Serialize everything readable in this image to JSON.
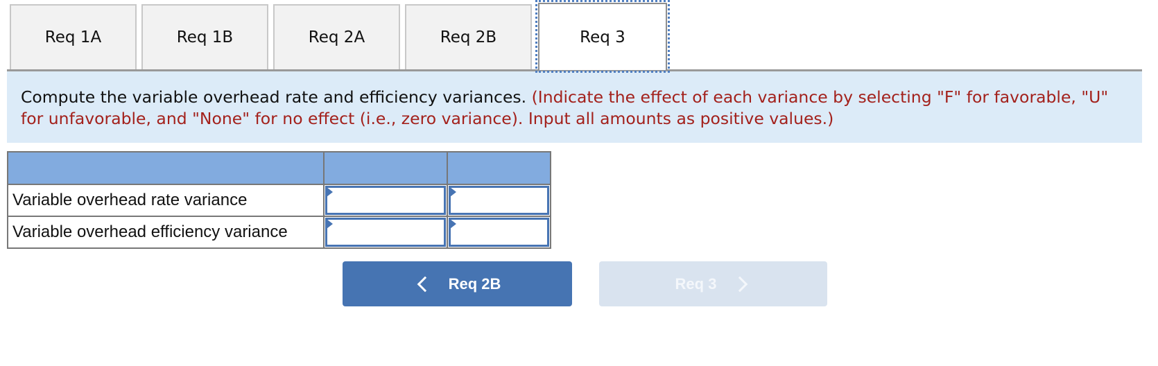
{
  "tabs": [
    {
      "label": "Req 1A",
      "active": false
    },
    {
      "label": "Req 1B",
      "active": false
    },
    {
      "label": "Req 2A",
      "active": false
    },
    {
      "label": "Req 2B",
      "active": false
    },
    {
      "label": "Req 3",
      "active": true
    }
  ],
  "instructions": {
    "main": "Compute the variable overhead rate and efficiency variances.",
    "note": "(Indicate the effect of each variance by selecting \"F\" for favorable, \"U\" for unfavorable, and \"None\" for no effect (i.e., zero variance). Input all amounts as positive values.)"
  },
  "table": {
    "headers": [
      "",
      "",
      ""
    ],
    "rows": [
      {
        "label": "Variable overhead rate variance",
        "amount": "",
        "effect": ""
      },
      {
        "label": "Variable overhead efficiency variance",
        "amount": "",
        "effect": ""
      }
    ]
  },
  "navigation": {
    "prev_label": "Req 2B",
    "next_label": "Req 3",
    "next_disabled": true
  },
  "colors": {
    "accent": "#4674b2",
    "header_bg": "#82abdf",
    "panel_bg": "#dcebf8",
    "note_text": "#a3211c",
    "disabled_btn": "#d9e3ef"
  }
}
